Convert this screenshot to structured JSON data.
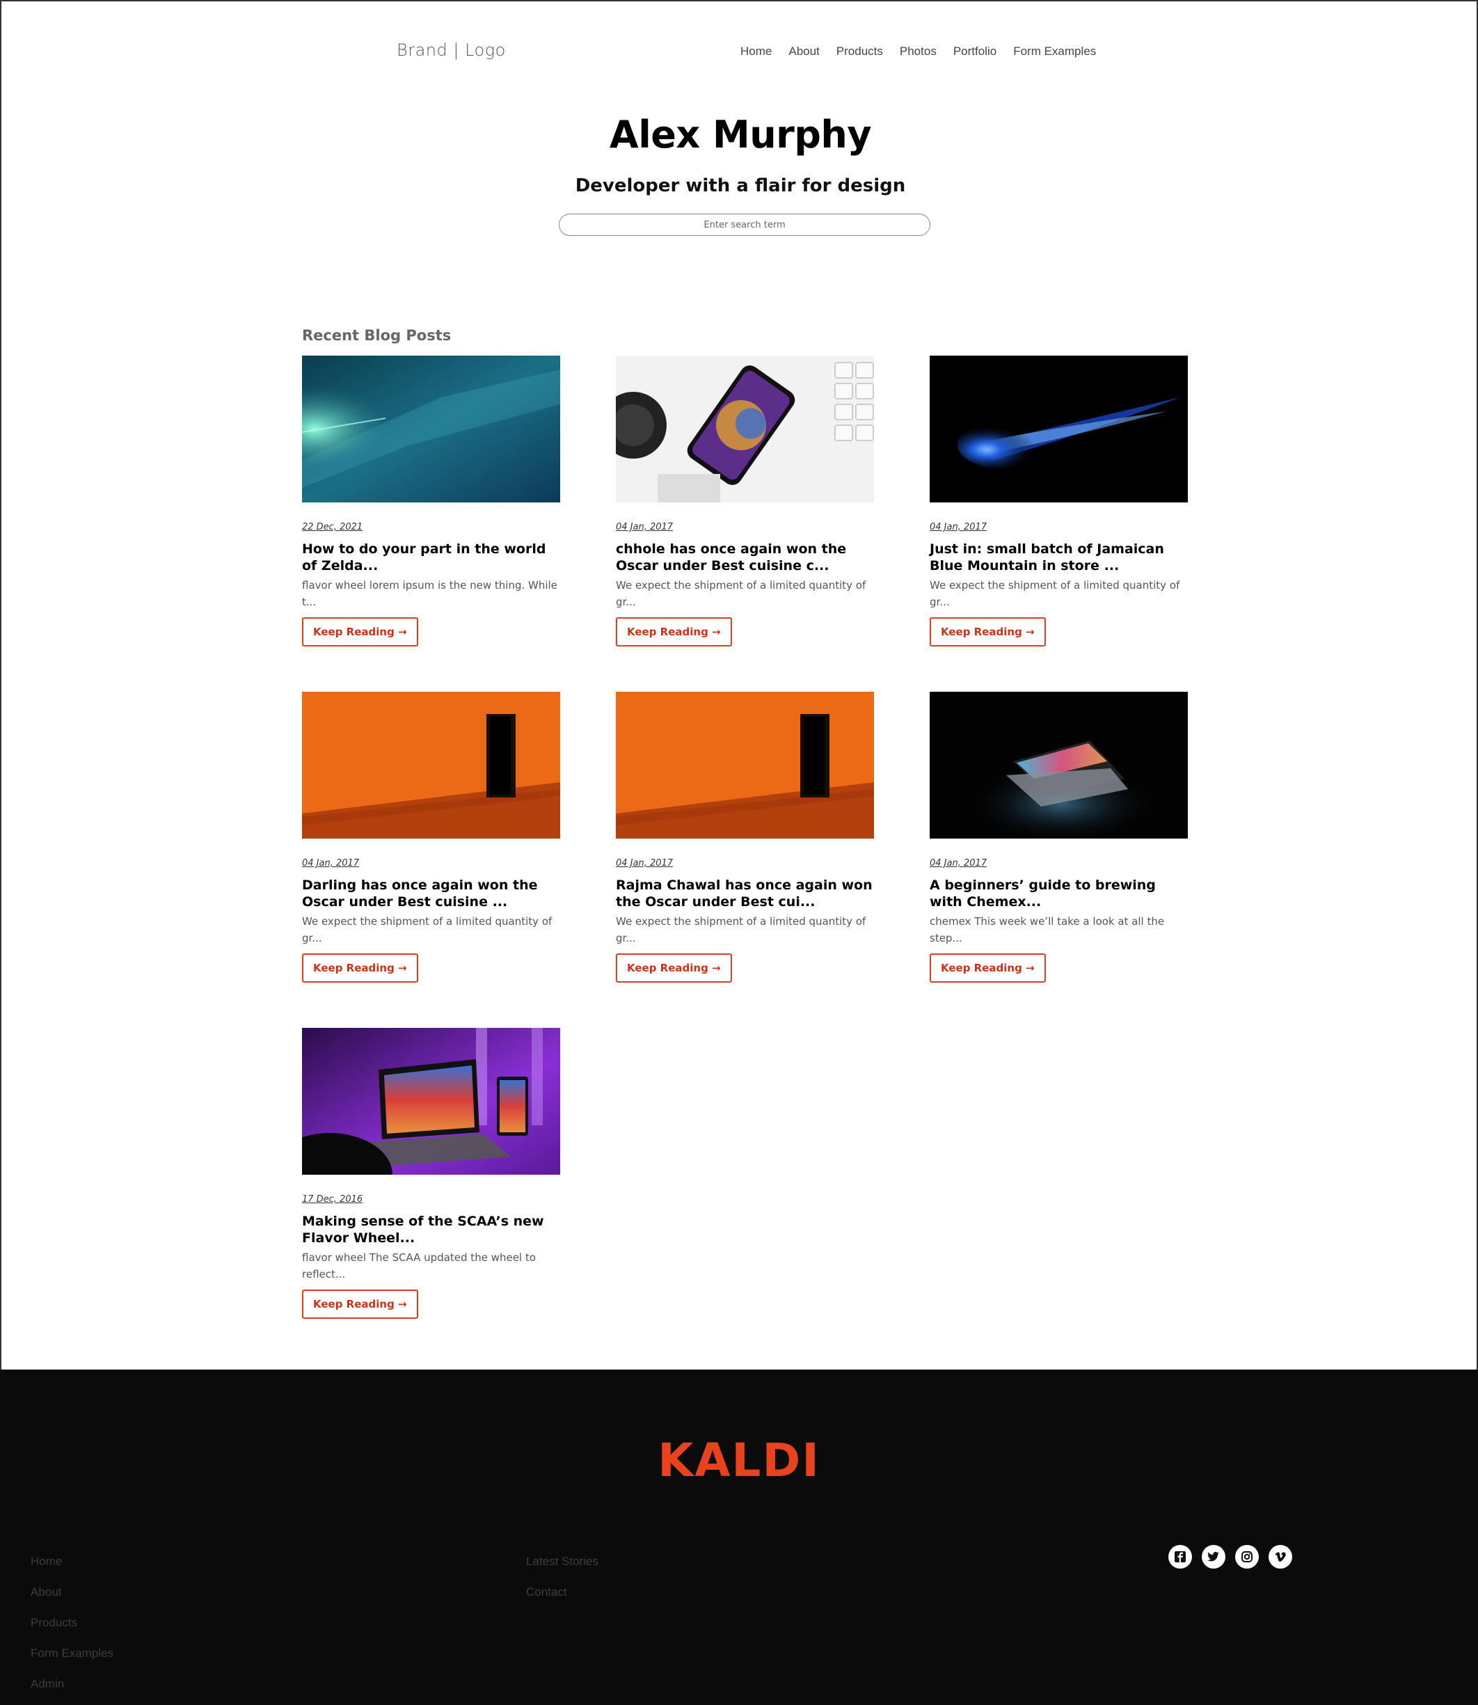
{
  "header": {
    "brand": "Brand | Logo",
    "nav": [
      "Home",
      "About",
      "Products",
      "Photos",
      "Portfolio",
      "Form Examples"
    ]
  },
  "hero": {
    "title": "Alex Murphy",
    "subtitle": "Developer with a flair for design",
    "search_placeholder": "Enter search term"
  },
  "posts_section": {
    "title": "Recent Blog Posts",
    "button_label": "Keep Reading →",
    "posts": [
      {
        "date": "22 Dec, 2021",
        "title": "How to do your part in the world of Zelda...",
        "excerpt": "flavor wheel lorem ipsum is the new thing. While t...",
        "image": "space-nebula"
      },
      {
        "date": "04 Jan, 2017",
        "title": "chhole has once again won the Oscar under Best cuisine c...",
        "excerpt": "We expect the shipment of a limited quantity of gr...",
        "image": "phone-on-desk"
      },
      {
        "date": "04 Jan, 2017",
        "title": "Just in: small batch of Jamaican Blue Mountain in store ...",
        "excerpt": "We expect the shipment of a limited quantity of gr...",
        "image": "blue-comet"
      },
      {
        "date": "04 Jan, 2017",
        "title": "Darling has once again won the Oscar under Best cuisine ...",
        "excerpt": "We expect the shipment of a limited quantity of gr...",
        "image": "orange-room"
      },
      {
        "date": "04 Jan, 2017",
        "title": "Rajma Chawal has once again won the Oscar under Best cui...",
        "excerpt": "We expect the shipment of a limited quantity of gr...",
        "image": "orange-room"
      },
      {
        "date": "04 Jan, 2017",
        "title": "A beginners’ guide to brewing with Chemex...",
        "excerpt": "chemex This week we’ll take a look at all the step...",
        "image": "laptop-glow"
      },
      {
        "date": "17 Dec, 2016",
        "title": "Making sense of the SCAA’s new Flavor Wheel...",
        "excerpt": "flavor wheel The SCAA updated the wheel to reflect...",
        "image": "purple-desk"
      }
    ]
  },
  "footer": {
    "logo": "KALDI",
    "col1": [
      "Home",
      "About",
      "Products",
      "Form Examples",
      "Admin"
    ],
    "col2": [
      "Latest Stories",
      "Contact"
    ],
    "social": [
      "facebook-icon",
      "twitter-icon",
      "instagram-icon",
      "vimeo-icon"
    ]
  },
  "colors": {
    "accent": "#d9401f",
    "footer_bg": "#0b0b0c",
    "logo": "#e8431c"
  }
}
